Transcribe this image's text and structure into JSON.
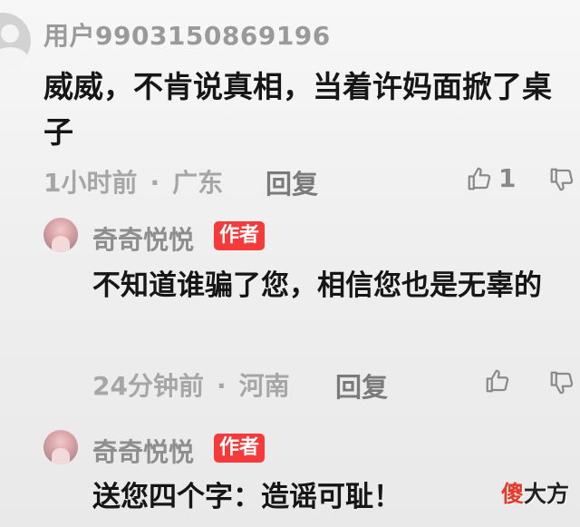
{
  "main_comment": {
    "username": "用户9903150869196",
    "text": "威威，不肯说真相，当着许妈面掀了桌子",
    "time": "1小时前",
    "location": "广东",
    "reply_label": "回复",
    "like_count": "1"
  },
  "replies": [
    {
      "author": "奇奇悦悦",
      "badge": "作者",
      "text": "不知道谁骗了您，相信您也是无辜的",
      "time": "24分钟前",
      "location": "河南",
      "reply_label": "回复"
    },
    {
      "author": "奇奇悦悦",
      "badge": "作者",
      "text": "送您四个字：造谣可耻！"
    }
  ],
  "meta_separator": "·",
  "watermark": {
    "part1": "傻",
    "part2": "大方"
  },
  "colors": {
    "badge": "#f43a3a",
    "text": "#161616",
    "meta": "#a6a6a6"
  }
}
